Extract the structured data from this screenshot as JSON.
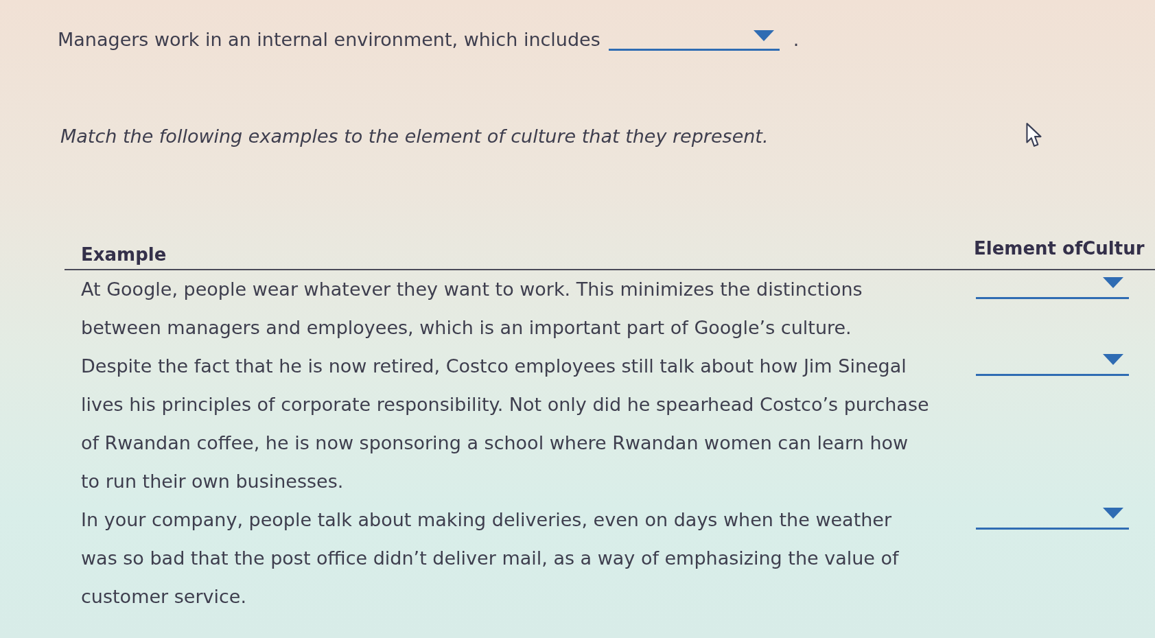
{
  "fill_in": {
    "before": "Managers work in an internal environment, which includes",
    "after": "."
  },
  "instruction": "Match the following examples to the element of culture that they represent.",
  "table": {
    "columns": [
      "Example",
      "Element ofCultur"
    ],
    "rows": [
      {
        "example": "At Google, people wear whatever they want to work. This minimizes the distinctions between managers and employees, which is an important part of Google’s culture."
      },
      {
        "example": "Despite the fact that he is now retired, Costco employees still talk about how Jim Sinegal lives his principles of corporate responsibility. Not only did he spearhead Costco’s purchase of Rwandan coffee, he is now sponsoring a school where Rwandan women can learn how to run their own businesses."
      },
      {
        "example": "In your company, people talk about making deliveries, even on days when the weather was so bad that the post office didn’t deliver mail, as a way of emphasizing the value of customer service."
      }
    ]
  }
}
